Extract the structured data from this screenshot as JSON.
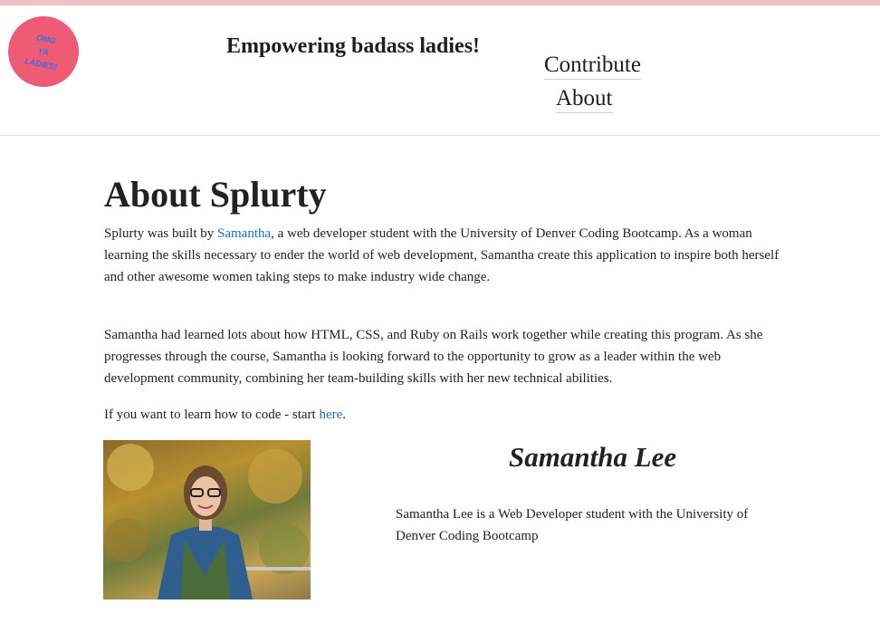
{
  "header": {
    "logo_lines": [
      "OMG",
      "YA",
      "LADIES!"
    ],
    "tagline": "Empowering badass ladies!",
    "nav": [
      {
        "label": "Contribute"
      },
      {
        "label": "About"
      }
    ]
  },
  "main": {
    "title": "About Splurty",
    "para1": {
      "before": "Splurty was built by ",
      "link": "Samantha",
      "after": ", a web developer student with the University of Denver Coding Bootcamp. As a woman learning the skills necessary to ender the world of web development, Samantha create this application to inspire both herself and other awesome women taking steps to make industry wide change."
    },
    "para2": "Samantha had learned lots about how HTML, CSS, and Ruby on Rails work together while creating this program. As she progresses through the course, Samantha is looking forward to the opportunity to grow as a leader within the web development community, combining her team-building skills with her new technical abilities.",
    "para3": {
      "before": "If you want to learn how to code - start ",
      "link": "here",
      "after": "."
    },
    "profile": {
      "name": "Samantha Lee",
      "bio": "Samantha Lee is a Web Developer student with the University of Denver Coding Bootcamp"
    }
  }
}
